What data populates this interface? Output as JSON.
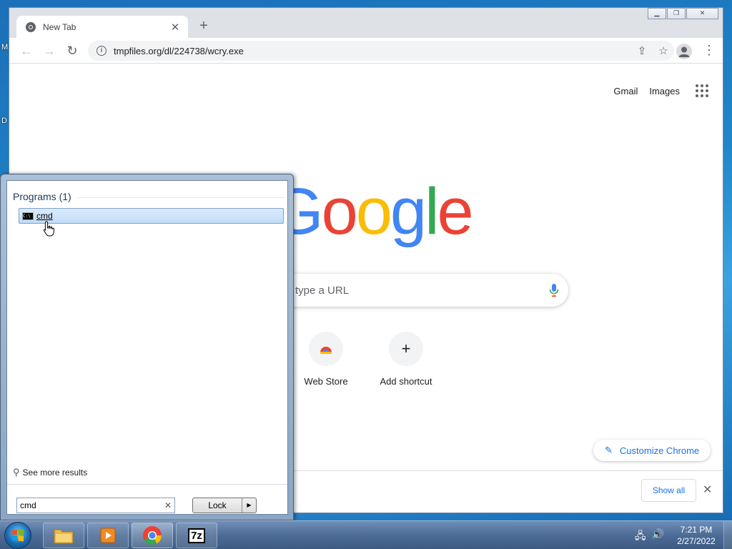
{
  "desktop": {
    "letters": [
      "M",
      "D"
    ]
  },
  "chrome": {
    "tab": {
      "title": "New Tab"
    },
    "window_controls": {
      "minimize": "▁",
      "restore": "❐",
      "close": "✕"
    },
    "toolbar": {
      "url": "tmpfiles.org/dl/224738/wcry.exe"
    },
    "ntp": {
      "gmail": "Gmail",
      "images": "Images",
      "logo": "Google",
      "logo_colors": [
        "#4285F4",
        "#EA4335",
        "#FBBC05",
        "#4285F4",
        "#34A853",
        "#EA4335"
      ],
      "search_placeholder": "type a URL",
      "shortcuts": [
        {
          "label": "Web Store",
          "icon": "chrome-web-store-icon"
        },
        {
          "label": "Add shortcut",
          "icon": "plus-icon"
        }
      ],
      "customize_label": "Customize Chrome"
    },
    "download_bar": {
      "show_all": "Show all"
    }
  },
  "start_menu": {
    "heading": "Programs (1)",
    "results": [
      {
        "label": "cmd",
        "icon": "cmd-icon"
      }
    ],
    "see_more": "See more results",
    "search_value": "cmd",
    "lock_label": "Lock"
  },
  "taskbar": {
    "apps": [
      "windows-explorer",
      "media-player",
      "chrome",
      "7zip"
    ],
    "sevenzip_label": "7z",
    "time": "7:21 PM",
    "date": "2/27/2022"
  },
  "colors": {
    "accent": "#1a73e8",
    "selection": "#c1dcf8"
  }
}
